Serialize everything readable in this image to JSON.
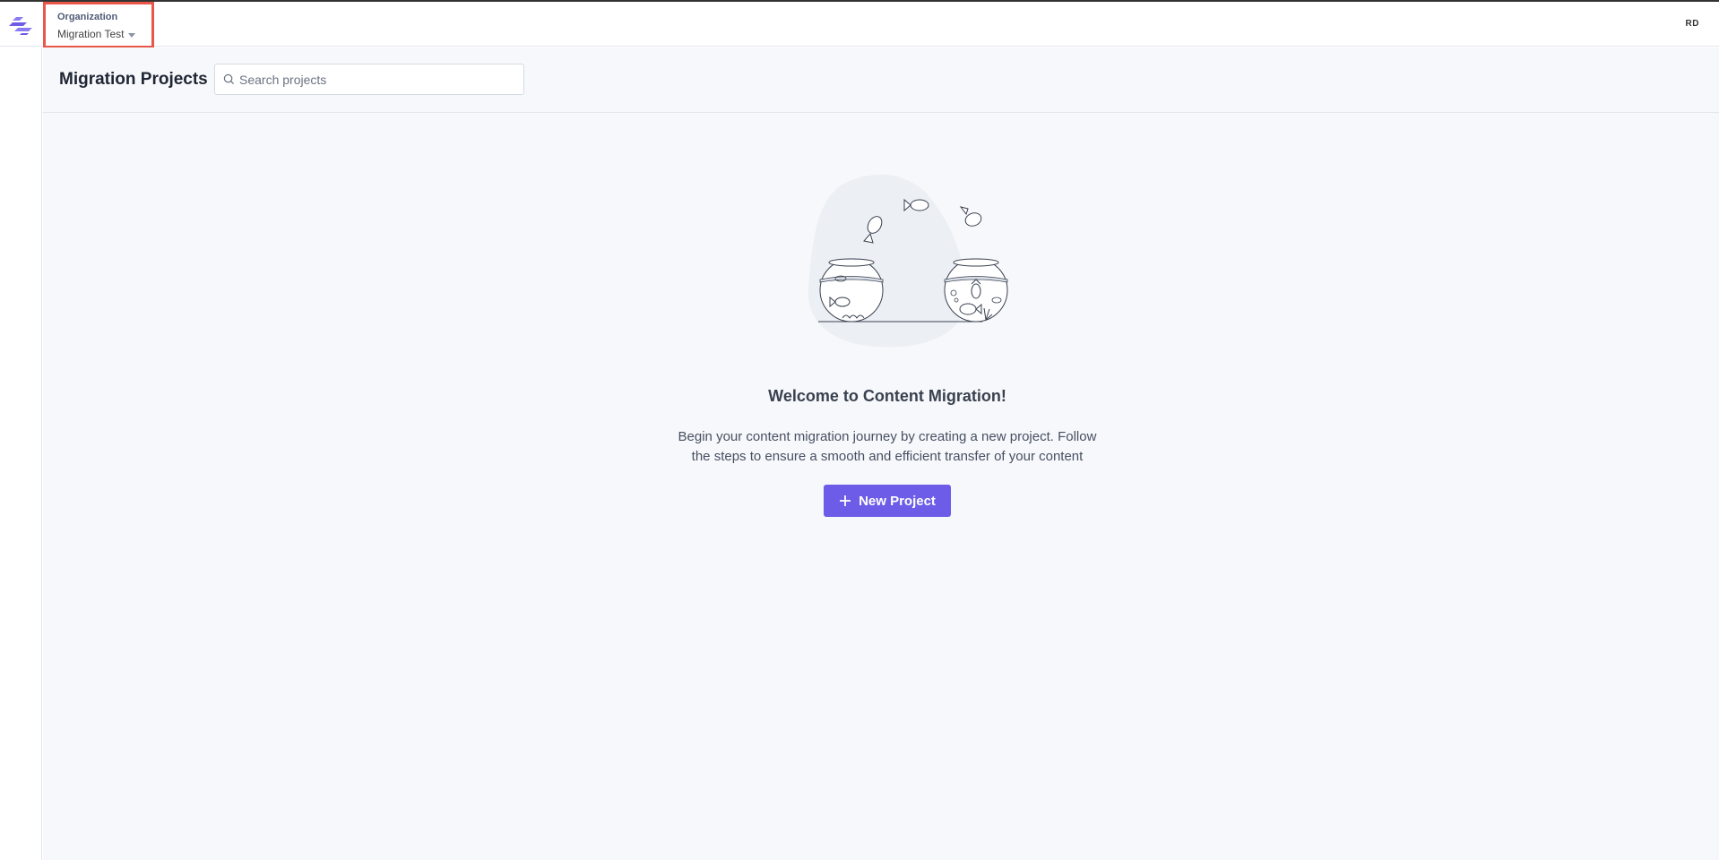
{
  "topbar": {
    "org_label": "Organization",
    "org_value": "Migration Test",
    "avatar_initials": "RD",
    "logo_icon": "brand-logo-icon",
    "caret_icon": "caret-down-icon"
  },
  "header": {
    "title": "Migration Projects",
    "search_placeholder": "Search projects",
    "search_icon": "search-icon"
  },
  "empty_state": {
    "illustration": "fishbowls-illustration",
    "title": "Welcome to Content Migration!",
    "description_line1": "Begin your content migration journey by creating a new project. Follow",
    "description_line2": "the steps to ensure a smooth and efficient transfer of your content",
    "button_label": "New Project",
    "button_icon": "plus-icon"
  },
  "colors": {
    "accent": "#6c5ce7",
    "highlight_border": "#e8574a",
    "background": "#f7f8fb"
  }
}
